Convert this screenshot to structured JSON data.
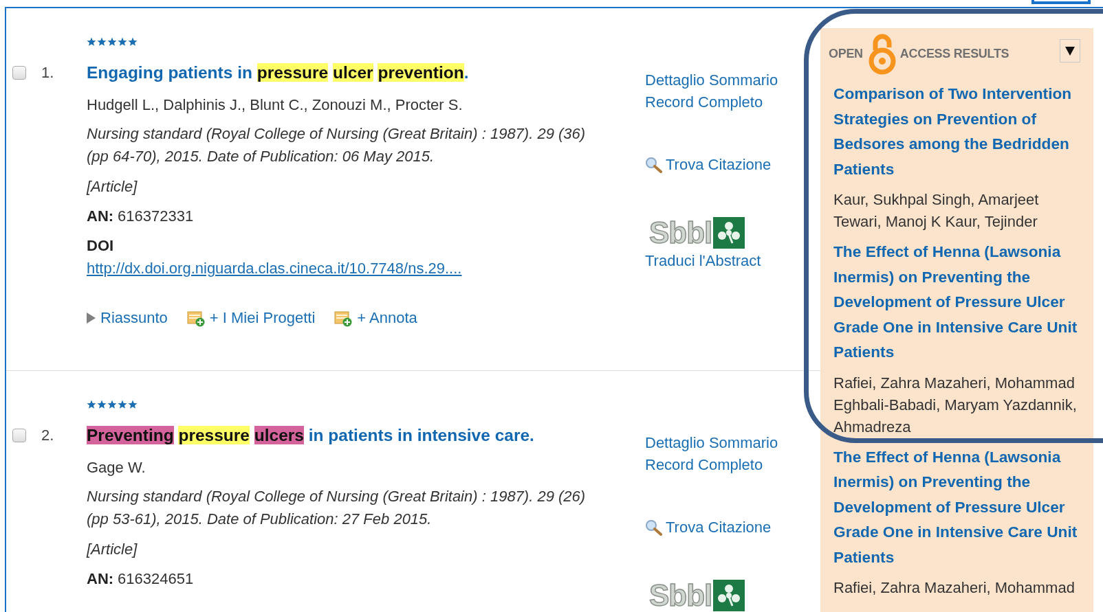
{
  "records": [
    {
      "number": "1.",
      "checked": false,
      "stars": 5,
      "title": [
        {
          "text": "Engaging patients in "
        },
        {
          "text": "pressure ",
          "color": "#ffff66"
        },
        {
          "text": "ulcer ",
          "color": "#ffff66"
        },
        {
          "text": "prevention",
          "color": "#ffff66"
        },
        {
          "text": "."
        }
      ],
      "authors": "Hudgell L., Dalphinis J., Blunt C., Zonouzi M., Procter S.",
      "source": "Nursing standard (Royal College of Nursing (Great Britain) : 1987). 29 (36) (pp 64-70), 2015. Date of Publication: 06 May 2015.",
      "pub_type": "[Article]",
      "an_label": "AN:",
      "an_value": "616372331",
      "doi_label": "DOI",
      "doi_link": "http://dx.doi.org.niguarda.clas.cineca.it/10.7748/ns.29....",
      "actions": [
        {
          "kind": "toggle",
          "label": "Riassunto"
        },
        {
          "kind": "add",
          "label": "+ I Miei Progetti"
        },
        {
          "kind": "add",
          "label": "+ Annota"
        }
      ],
      "side_links": [
        "Dettaglio Sommario",
        "Record Completo"
      ],
      "find_citation": "Trova Citazione",
      "logo_text": "Sbbl",
      "translate_link": "Traduci l'Abstract"
    },
    {
      "number": "2.",
      "checked": false,
      "stars": 5,
      "title": [
        {
          "text": "Preventing ",
          "color": "#d4639c"
        },
        {
          "text": "pressure ",
          "color": "#ffff66"
        },
        {
          "text": "ulcers",
          "color": "#d4639c"
        },
        {
          "text": " in patients in intensive care."
        }
      ],
      "authors": "Gage W.",
      "source": "Nursing standard (Royal College of Nursing (Great Britain) : 1987). 29 (26) (pp 53-61), 2015. Date of Publication: 27 Feb 2015.",
      "pub_type": "[Article]",
      "an_label": "AN:",
      "an_value": "616324651",
      "side_links": [
        "Dettaglio Sommario",
        "Record Completo"
      ],
      "find_citation": "Trova Citazione",
      "logo_text": "Sbbl"
    }
  ],
  "open_access": {
    "label_open": "OPEN",
    "label_access": "ACCESS RESULTS",
    "items": [
      {
        "title": "Comparison of Two Intervention Strategies on Prevention of Bedsores among the Bedridden Patients",
        "authors": "Kaur, Sukhpal Singh, Amarjeet Tewari, Manoj K Kaur, Tejinder"
      },
      {
        "title": "The Effect of Henna (Lawsonia Inermis) on Preventing the Development of Pressure Ulcer Grade One in Intensive Care Unit Patients",
        "authors": "Rafiei, Zahra Mazaheri, Mohammad Eghbali-Babadi, Maryam Yazdannik, Ahmadreza"
      },
      {
        "title": "The Effect of Henna (Lawsonia Inermis) on Preventing the Development of Pressure Ulcer Grade One in Intensive Care Unit Patients",
        "authors": "Rafiei, Zahra Mazaheri, Mohammad"
      }
    ]
  }
}
